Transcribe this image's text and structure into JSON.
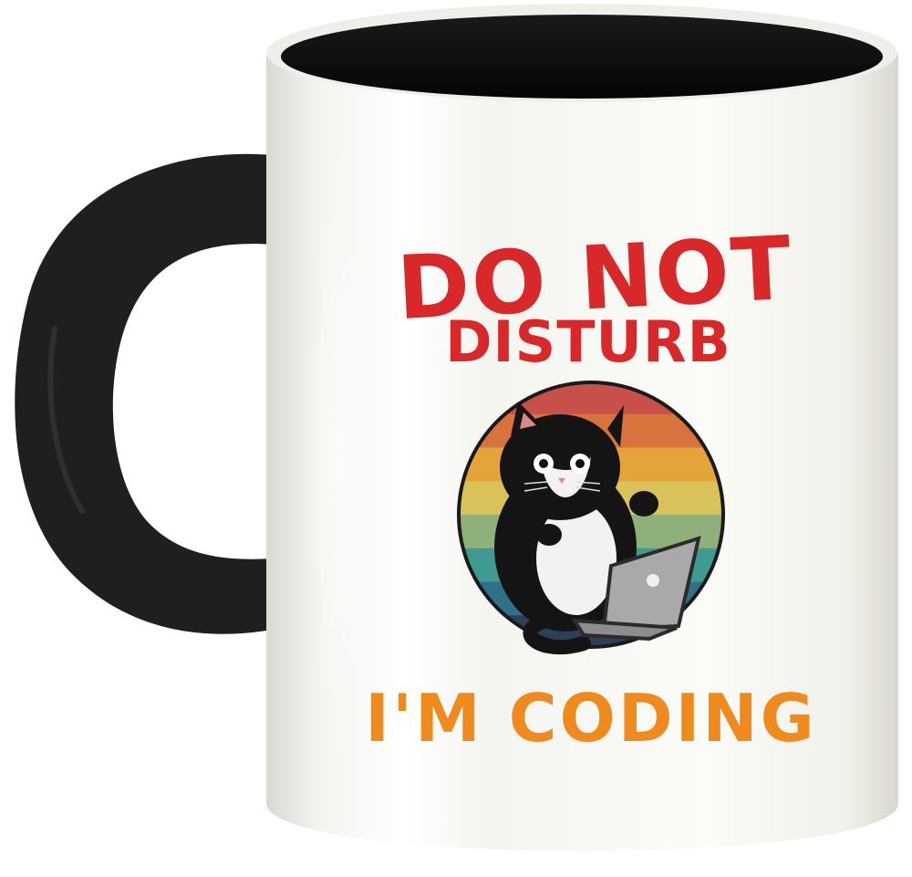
{
  "product": {
    "name": "mug",
    "colors": {
      "body": "#f7f7f2",
      "interior": "#161616",
      "handle": "#1f1f1f",
      "top_text": "#d9282a",
      "bottom_text": "#ee8a1e",
      "cat_fur": "#141414",
      "cat_chest": "#f2f2f2",
      "laptop": "#a9a9a9"
    },
    "print": {
      "line_1": "DO NOT",
      "line_2": "DISTURB",
      "line_3": "I'M CODING",
      "badge_stripes": [
        "#c8504a",
        "#d8733e",
        "#e4a43b",
        "#d9c25a",
        "#8fb07a",
        "#3f9a92",
        "#2f7287",
        "#2e3f5a"
      ],
      "illustration": "black-and-white cat sitting at a laptop on a retro striped circle"
    }
  }
}
